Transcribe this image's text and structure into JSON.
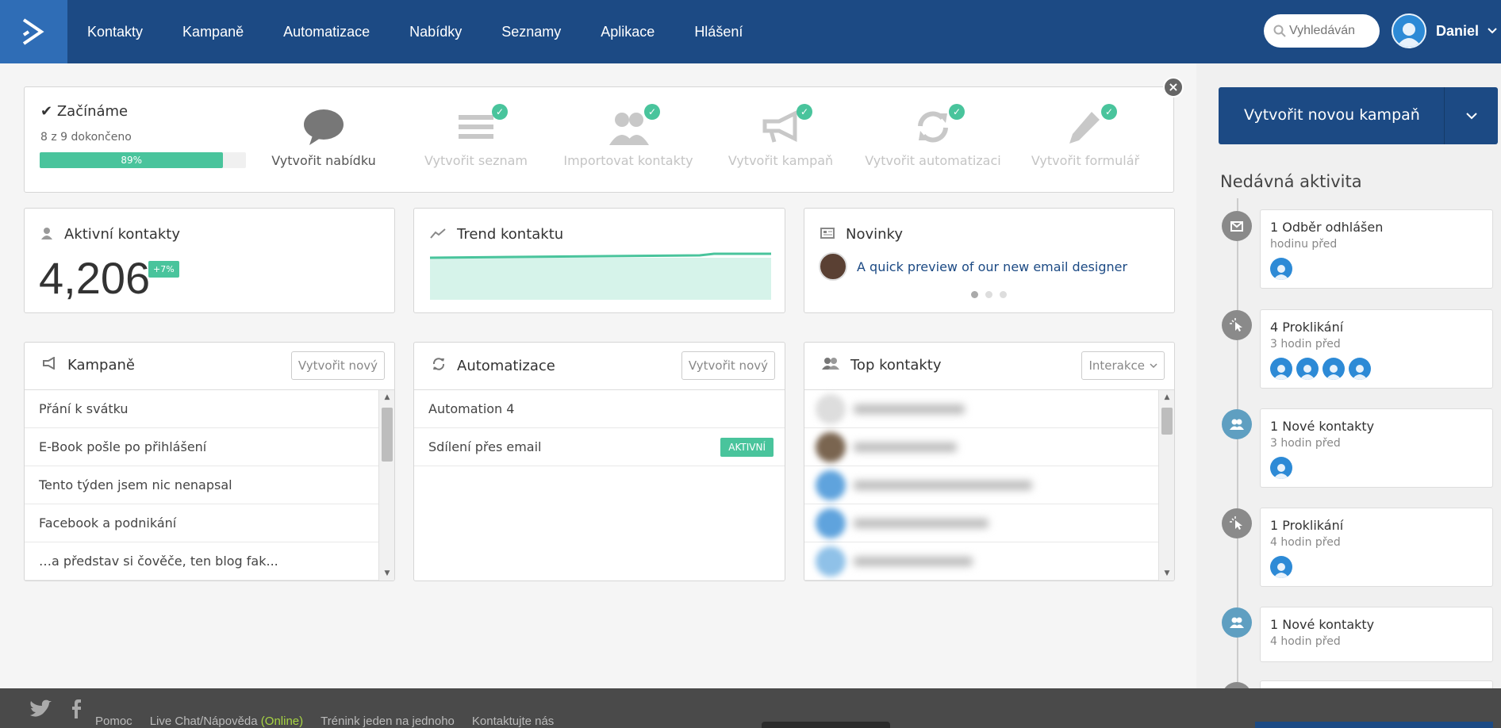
{
  "nav": {
    "items": [
      "Kontakty",
      "Kampaně",
      "Automatizace",
      "Nabídky",
      "Seznamy",
      "Aplikace",
      "Hlášení"
    ],
    "search_placeholder": "Vyhledáván",
    "user_name": "Daniel"
  },
  "getting_started": {
    "title": "Začínáme",
    "progress_text": "8 z 9 dokončeno",
    "progress_label": "89%",
    "progress_value": 0.89,
    "steps": [
      {
        "label": "Vytvořit nabídku",
        "icon": "chat-bubble-icon",
        "done": false
      },
      {
        "label": "Vytvořit seznam",
        "icon": "list-icon",
        "done": true
      },
      {
        "label": "Importovat kontakty",
        "icon": "users-icon",
        "done": true
      },
      {
        "label": "Vytvořit kampaň",
        "icon": "megaphone-icon",
        "done": true
      },
      {
        "label": "Vytvořit automatizaci",
        "icon": "refresh-icon",
        "done": true
      },
      {
        "label": "Vytvořit formulář",
        "icon": "pencil-icon",
        "done": true
      }
    ]
  },
  "active_contacts": {
    "title": "Aktivní kontakty",
    "count": "4,206",
    "delta": "+7%"
  },
  "contact_trend": {
    "title": "Trend kontaktu"
  },
  "news": {
    "title": "Novinky",
    "item": "A quick preview of our new email designer"
  },
  "campaigns": {
    "title": "Kampaně",
    "button": "Vytvořit nový",
    "items": [
      "Přání k svátku",
      "E-Book pošle po přihlášení",
      "Tento týden jsem nic nenapsal",
      "Facebook a podnikání",
      "…a představ si čověče, ten blog fak..."
    ]
  },
  "automations": {
    "title": "Automatizace",
    "button": "Vytvořit nový",
    "items": [
      {
        "name": "Automation 4",
        "status": ""
      },
      {
        "name": "Sdílení přes email",
        "status": "AKTIVNÍ"
      }
    ]
  },
  "top_contacts": {
    "title": "Top kontakty",
    "filter": "Interakce"
  },
  "sidebar": {
    "cta_label": "Vytvořit novou kampaň",
    "heading": "Nedávná aktivita",
    "activities": [
      {
        "title": "1 Odběr odhlášen",
        "time": "hodinu před",
        "avatars": 1,
        "icon": "unsubscribe-icon"
      },
      {
        "title": "4 Proklikání",
        "time": "3 hodin před",
        "avatars": 4,
        "icon": "click-icon"
      },
      {
        "title": "1 Nové kontakty",
        "time": "3 hodin před",
        "avatars": 1,
        "icon": "new-contacts-icon"
      },
      {
        "title": "1 Proklikání",
        "time": "4 hodin před",
        "avatars": 1,
        "icon": "click-icon"
      },
      {
        "title": "1 Nové kontakty",
        "time": "4 hodin před",
        "avatars": 0,
        "icon": "new-contacts-icon"
      }
    ]
  },
  "footer": {
    "links": [
      "Pomoc",
      "Live Chat/Nápověda",
      "Trénink jeden na jednoho",
      "Kontaktujte nás"
    ],
    "online_label": "(Online)"
  },
  "colors": {
    "nav_bg": "#1c4a84",
    "accent_green": "#49c49c",
    "logo_bg": "#2f6db6"
  }
}
